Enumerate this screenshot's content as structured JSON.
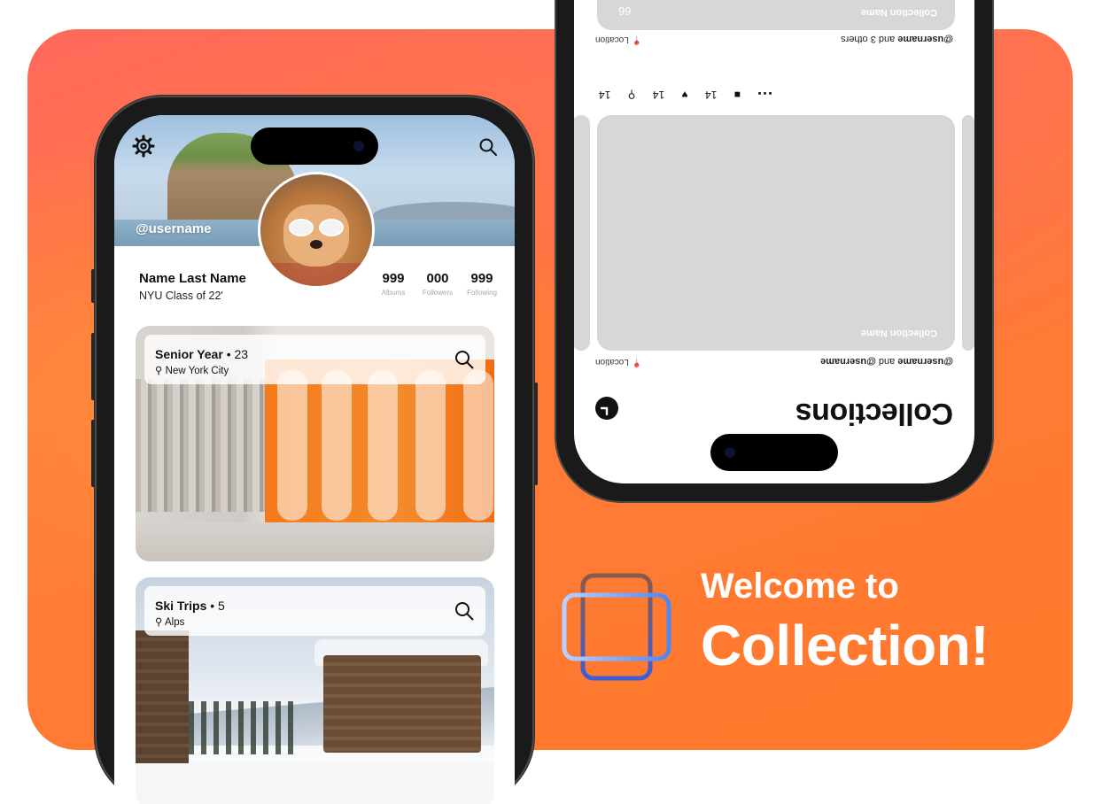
{
  "profile_screen": {
    "banner_username": "@username",
    "name": "Name Last Name",
    "subtitle": "NYU Class of 22'",
    "stats": [
      {
        "value": "999",
        "label": "Albums"
      },
      {
        "value": "000",
        "label": "Followers"
      },
      {
        "value": "999",
        "label": "Following"
      }
    ],
    "collections": [
      {
        "title": "Senior Year",
        "separator": "•",
        "count": "23",
        "location_icon": "location-pin-icon",
        "location": "New York City"
      },
      {
        "title": "Ski Trips",
        "separator": "•",
        "count": "5",
        "location_icon": "location-pin-icon",
        "location": "Alps"
      }
    ]
  },
  "collections_screen": {
    "title": "Collections",
    "feed": [
      {
        "owner": "@username",
        "connector": "and",
        "others": "@username",
        "location": "Location",
        "collection_name": "Collection Name"
      },
      {
        "owner": "@username",
        "connector": "and",
        "others": "3 others",
        "location": "Location",
        "collection_name": "Collection Name",
        "count": "66"
      }
    ],
    "reactions": [
      "14",
      "14",
      "14"
    ],
    "more": "..."
  },
  "branding": {
    "line1": "Welcome to",
    "line2": "Collection!",
    "colors": {
      "accent_orange": "#ff7a2a",
      "accent_coral": "#ff6a5c",
      "logo_blue": "#3a6de0",
      "logo_brown": "#8a5a4a"
    }
  }
}
